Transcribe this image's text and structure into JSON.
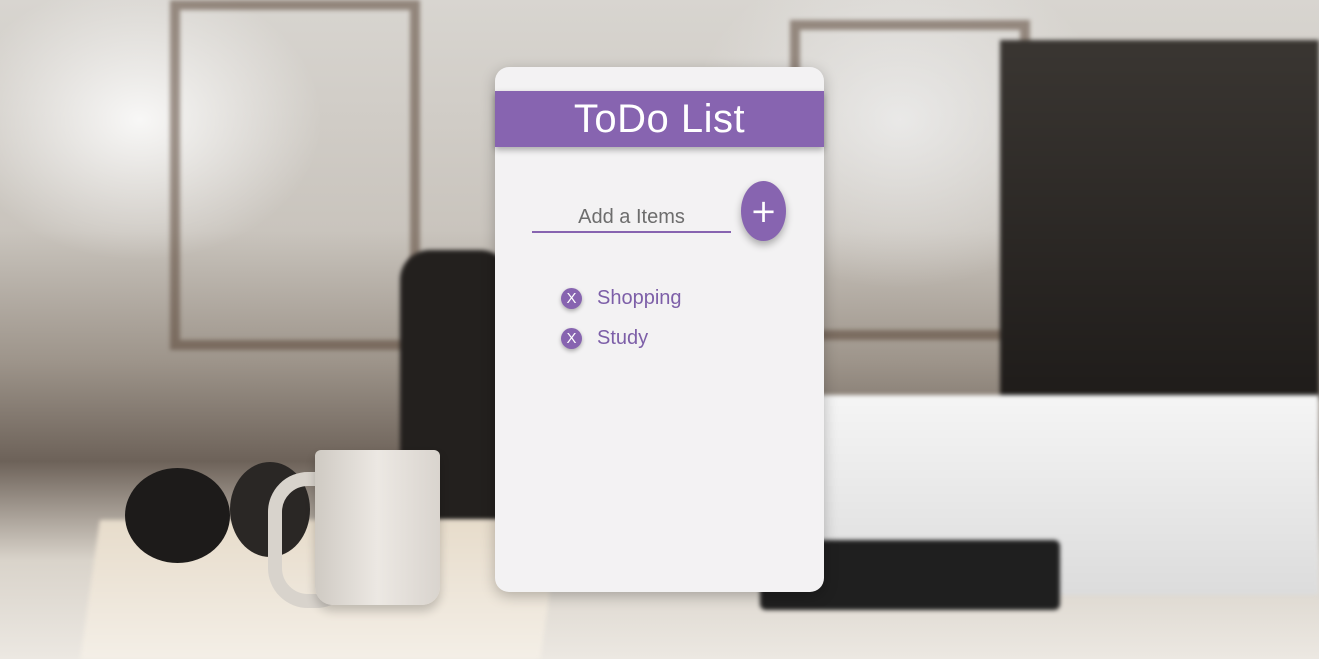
{
  "app": {
    "title": "ToDo List"
  },
  "input": {
    "placeholder": "Add a Items",
    "value": ""
  },
  "add_button": {
    "label": "+"
  },
  "items": [
    {
      "remove_label": "X",
      "label": "Shopping"
    },
    {
      "remove_label": "X",
      "label": "Study"
    }
  ],
  "colors": {
    "accent": "#8764b0",
    "card": "#f3f2f3",
    "item_text": "#7d5fa8"
  },
  "icons": {
    "remove": "close-icon",
    "add": "plus-icon"
  }
}
